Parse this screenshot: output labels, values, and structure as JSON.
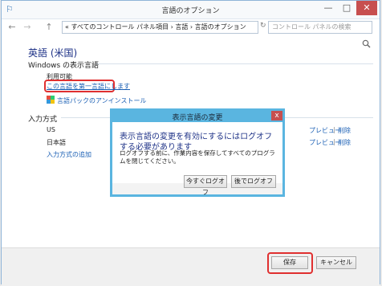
{
  "window": {
    "title": "言語のオプション",
    "controls": {
      "minimize": "—",
      "maximize": "□",
      "close": "✕"
    }
  },
  "nav": {
    "back": "←",
    "forward": "→",
    "up": "↑",
    "address": "«  すべてのコントロール パネル項目  ›  言語  ›  言語のオプション",
    "search_placeholder": "コントロール パネルの検索",
    "search_icon": "search-icon"
  },
  "main": {
    "heading": "英語 (米国)",
    "display_language": {
      "label": "Windows の表示言語",
      "status": "利用可能",
      "make_primary_link": "この言語を第一言語にします",
      "uninstall_link": "言語パックのアンインストール"
    },
    "input_methods": {
      "label": "入力方式",
      "items": [
        {
          "name": "US",
          "preview": "プレビュー",
          "sep": "|",
          "remove": "削除"
        },
        {
          "name": "日本語",
          "preview": "プレビュー",
          "sep": "|",
          "remove": "削除"
        }
      ],
      "add_link": "入力方式の追加"
    }
  },
  "dialog": {
    "title": "表示言語の変更",
    "close": "x",
    "heading": "表示言語の変更を有効にするにはログオフする必要があります",
    "message": "ログオフする前に、作業内容を保存してすべてのプログラムを閉じてください。",
    "logoff_now": "今すぐログオフ",
    "logoff_later": "後でログオフ"
  },
  "footer": {
    "save": "保存",
    "cancel": "キャンセル"
  },
  "colors": {
    "accent": "#1e3287",
    "link": "#1a5fb4",
    "highlight": "#e03030",
    "dialog_frame": "#5ab5e0"
  }
}
